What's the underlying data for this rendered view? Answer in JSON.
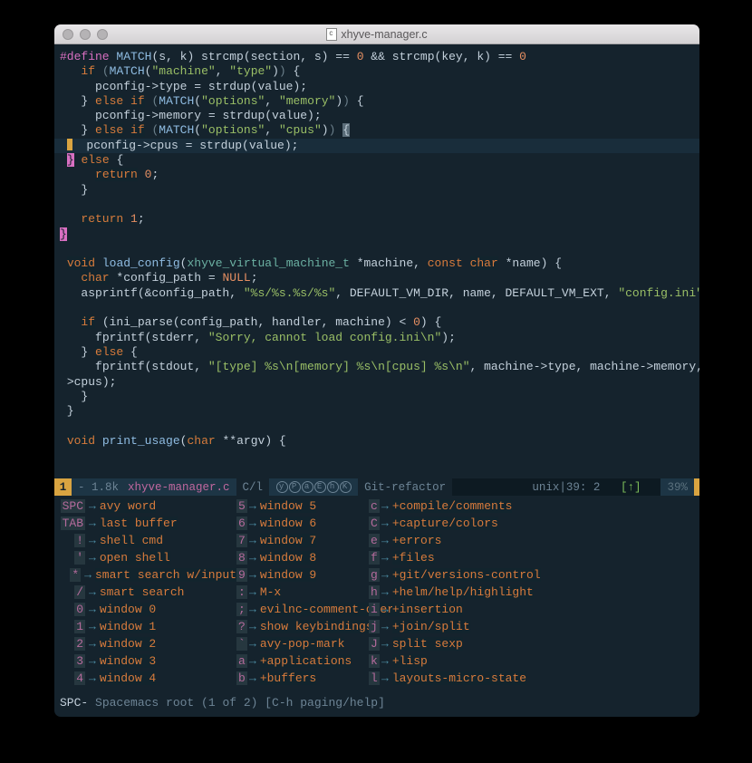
{
  "window": {
    "title": "xhyve-manager.c"
  },
  "code": {
    "l1": {
      "a": "#define",
      "b": "MATCH",
      "c": "(s, k) strcmp(section, s) == ",
      "d": "0",
      "e": " && strcmp(key, k) == ",
      "f": "0"
    },
    "l2": {
      "a": "if",
      "b": "MATCH",
      "c": "\"machine\"",
      "d": "\"type\""
    },
    "l3": {
      "a": "pconfig->type = strdup(value);"
    },
    "l4": {
      "a": "else",
      "b": "if",
      "c": "MATCH",
      "d": "\"options\"",
      "e": "\"memory\""
    },
    "l5": {
      "a": "pconfig->memory = strdup(value);"
    },
    "l6": {
      "a": "else",
      "b": "if",
      "c": "MATCH",
      "d": "\"options\"",
      "e": "\"cpus\""
    },
    "l7": {
      "a": "pconfig->cpus = strdup(value);"
    },
    "l8": {
      "a": "else"
    },
    "l9": {
      "a": "return",
      "b": "0"
    },
    "l10": {
      "a": "return",
      "b": "1"
    },
    "l11": {
      "a": "void",
      "b": "load_config",
      "c": "xhyve_virtual_machine_t",
      "d": "machine",
      "e": "const",
      "f": "char",
      "g": "name"
    },
    "l12": {
      "a": "char",
      "b": "config_path",
      "c": "NULL"
    },
    "l13": {
      "a": "asprintf(&config_path, ",
      "b": "\"%s/%s.%s/%s\"",
      "c": ", DEFAULT_VM_DIR, name, DEFAULT_VM_EXT, ",
      "d": "\"config.ini\"",
      "e": ");"
    },
    "l14": {
      "a": "if",
      "b": " (ini_parse(config_path, handler, machine) < ",
      "c": "0",
      "d": ") {"
    },
    "l15": {
      "a": "fprintf(stderr, ",
      "b": "\"Sorry, cannot load config.ini\\n\"",
      "c": ");"
    },
    "l16": {
      "a": "else"
    },
    "l17": {
      "a": "fprintf(stdout, ",
      "b": "\"[type] %s\\n[memory] %s\\n[cpus] %s\\n\"",
      "c": ", machine->type, machine->memory, machine-"
    },
    "l18": {
      "a": ">cpus);"
    },
    "l19": {
      "a": "void",
      "b": "print_usage",
      "c": "char",
      "d": "argv"
    }
  },
  "modeline": {
    "num": "1",
    "size": "- 1.8k",
    "file": "xhyve-manager.c",
    "cl": "C/l",
    "pills": "ⓨⓅⓐⒺⓗⓀ",
    "branch": "Git-refactor",
    "enc": "unix",
    "pos": "39: 2",
    "flag": "[↑]",
    "pct": "39%"
  },
  "whichkey": {
    "cols": [
      [
        {
          "k": "SPC",
          "d": "avy word"
        },
        {
          "k": "TAB",
          "d": "last buffer"
        },
        {
          "k": "!",
          "d": "shell cmd"
        },
        {
          "k": "'",
          "d": "open shell"
        },
        {
          "k": "*",
          "d": "smart search w/input"
        },
        {
          "k": "/",
          "d": "smart search"
        },
        {
          "k": "0",
          "d": "window 0"
        },
        {
          "k": "1",
          "d": "window 1"
        },
        {
          "k": "2",
          "d": "window 2"
        },
        {
          "k": "3",
          "d": "window 3"
        },
        {
          "k": "4",
          "d": "window 4"
        }
      ],
      [
        {
          "k": "5",
          "d": "window 5"
        },
        {
          "k": "6",
          "d": "window 6"
        },
        {
          "k": "7",
          "d": "window 7"
        },
        {
          "k": "8",
          "d": "window 8"
        },
        {
          "k": "9",
          "d": "window 9"
        },
        {
          "k": ":",
          "d": "M-x"
        },
        {
          "k": ";",
          "d": "evilnc-comment-operator"
        },
        {
          "k": "?",
          "d": "show keybindings"
        },
        {
          "k": "`",
          "d": "avy-pop-mark"
        },
        {
          "k": "a",
          "d": "+applications"
        },
        {
          "k": "b",
          "d": "+buffers"
        }
      ],
      [
        {
          "k": "c",
          "d": "+compile/comments"
        },
        {
          "k": "C",
          "d": "+capture/colors"
        },
        {
          "k": "e",
          "d": "+errors"
        },
        {
          "k": "f",
          "d": "+files"
        },
        {
          "k": "g",
          "d": "+git/versions-control"
        },
        {
          "k": "h",
          "d": "+helm/help/highlight"
        },
        {
          "k": "i",
          "d": "+insertion"
        },
        {
          "k": "j",
          "d": "+join/split"
        },
        {
          "k": "J",
          "d": "split sexp"
        },
        {
          "k": "k",
          "d": "+lisp"
        },
        {
          "k": "l",
          "d": "layouts-micro-state"
        }
      ]
    ]
  },
  "minibuffer": {
    "prompt": "SPC-",
    "text": " Spacemacs root (1 of 2) [C-h paging/help]"
  }
}
